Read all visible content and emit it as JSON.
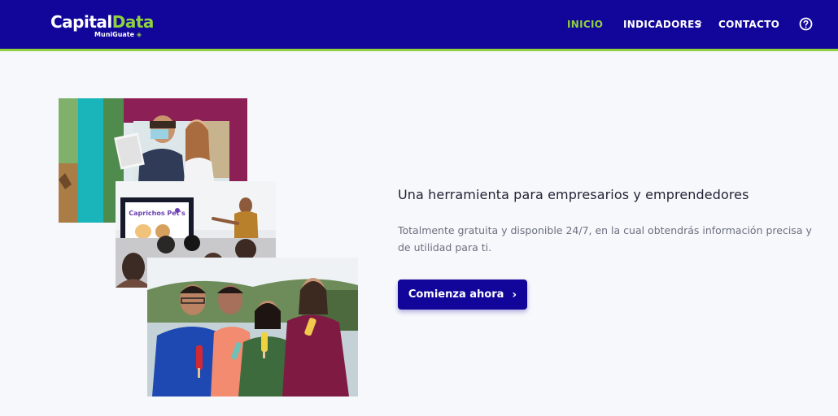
{
  "brand": {
    "name_part1": "Capital",
    "name_part2": "Data",
    "sub": "MuniGuate",
    "colors": {
      "primary": "#12069a",
      "accent": "#8fd13f"
    }
  },
  "nav": {
    "items": [
      {
        "label": "INICIO",
        "active": true
      },
      {
        "label": "INDICADORES",
        "has_dropdown": true
      },
      {
        "label": "CONTACTO"
      }
    ],
    "help_icon": "help-circle-icon"
  },
  "hero": {
    "title": "Una herramienta para empresarios y emprendedores",
    "description": "Totalmente gratuita y disponible 24/7, en la cual obtendrás información precisa y de utilidad para ti.",
    "cta_label": "Comienza ahora",
    "cta_icon": "›"
  },
  "photos": {
    "slide_title": "Caprichos Pet's"
  }
}
